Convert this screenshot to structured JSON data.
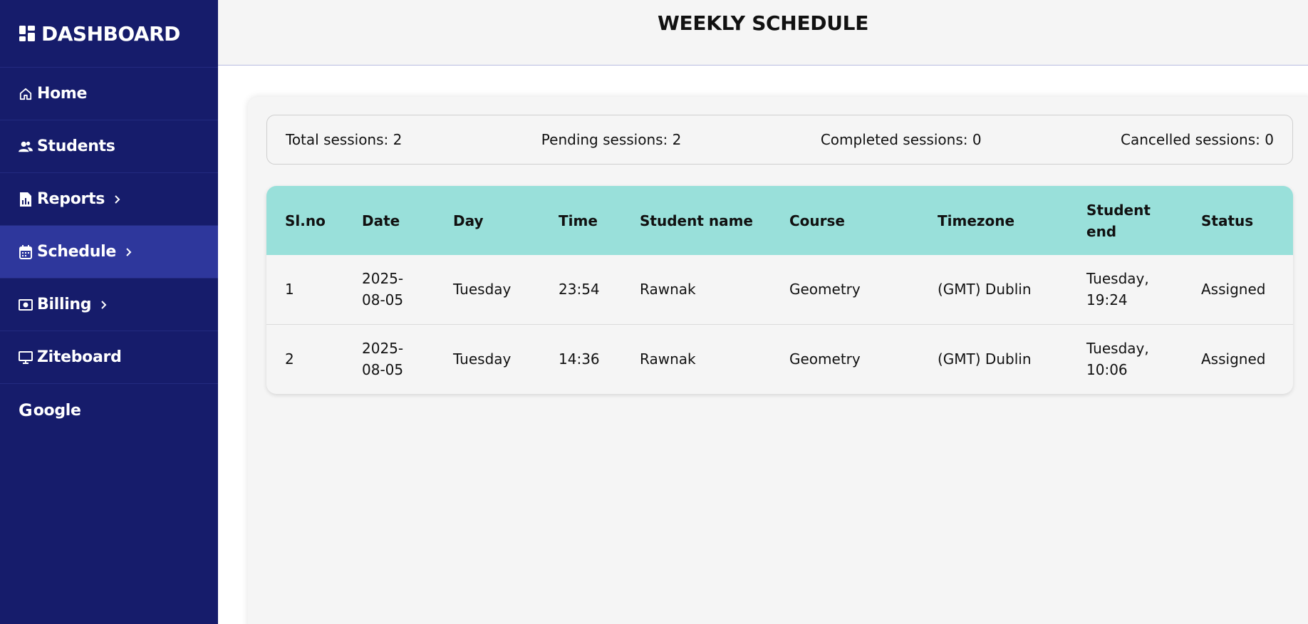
{
  "sidebar": {
    "title": "DASHBOARD",
    "items": [
      {
        "label": "Home",
        "icon": "home-icon",
        "has_chevron": false
      },
      {
        "label": "Students",
        "icon": "students-icon",
        "has_chevron": false
      },
      {
        "label": "Reports",
        "icon": "report-icon",
        "has_chevron": true
      },
      {
        "label": "Schedule",
        "icon": "calendar-icon",
        "has_chevron": true,
        "active": true
      },
      {
        "label": "Billing",
        "icon": "money-icon",
        "has_chevron": true
      },
      {
        "label": "Ziteboard",
        "icon": "presentation-board-icon",
        "has_chevron": false
      },
      {
        "label": "oogle",
        "prefix_glyph": "G",
        "icon": "google-icon",
        "has_chevron": false
      }
    ],
    "colors": {
      "background": "#161c6b",
      "active": "#2e379c"
    }
  },
  "header": {
    "title": "WEEKLY SCHEDULE"
  },
  "stats": {
    "total": "Total sessions: 2",
    "pending": "Pending sessions: 2",
    "completed": "Completed sessions: 0",
    "cancelled": "Cancelled sessions: 0"
  },
  "table": {
    "header_color": "#99e0da",
    "columns": [
      "Sl.no",
      "Date",
      "Day",
      "Time",
      "Student name",
      "Course",
      "Timezone",
      "Student\nend",
      "Status"
    ],
    "rows": [
      [
        "1",
        "2025-\n08-05",
        "Tuesday",
        "23:54",
        "Rawnak",
        "Geometry",
        "(GMT) Dublin",
        "Tuesday,\n19:24",
        "Assigned"
      ],
      [
        "2",
        "2025-\n08-05",
        "Tuesday",
        "14:36",
        "Rawnak",
        "Geometry",
        "(GMT) Dublin",
        "Tuesday,\n10:06",
        "Assigned"
      ]
    ]
  }
}
